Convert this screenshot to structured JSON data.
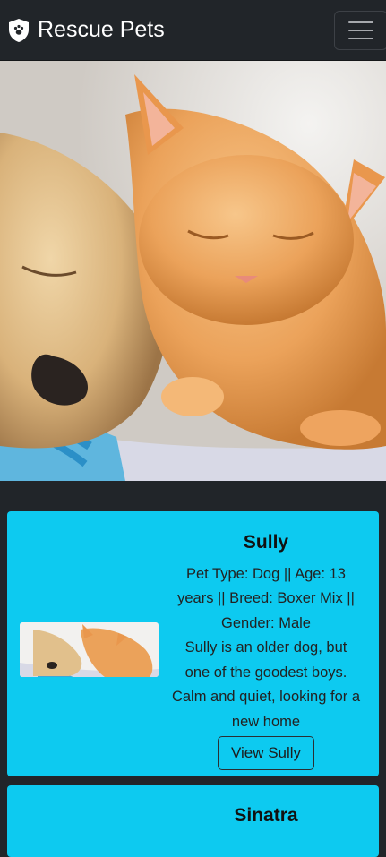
{
  "navbar": {
    "brand": "Rescue Pets",
    "brand_icon": "shield-paw-icon",
    "toggle_icon": "hamburger-icon"
  },
  "hero": {
    "alt": "puppy and kitten sleeping"
  },
  "pets": [
    {
      "name": "Sully",
      "details": "Pet Type: Dog || Age: 13 years || Breed: Boxer Mix || Gender: Male",
      "description": "Sully is an older dog, but one of the goodest boys. Calm and quiet, looking for a new home",
      "button": "View Sully"
    },
    {
      "name": "Sinatra"
    }
  ],
  "colors": {
    "navbar_bg": "#212529",
    "card_bg": "#0dcaf0"
  }
}
